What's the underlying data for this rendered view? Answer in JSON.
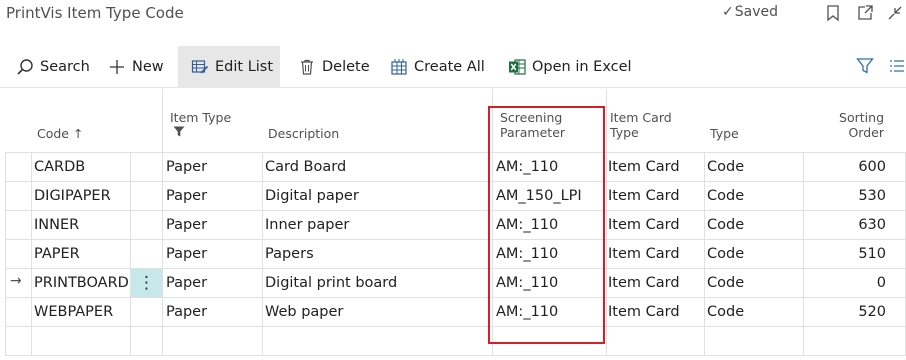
{
  "page": {
    "title": "PrintVis Item Type Code",
    "saved_label": "Saved",
    "icons": [
      "bookmark-icon",
      "open-new-window-icon",
      "collapse-icon"
    ]
  },
  "actions": {
    "search": "Search",
    "new": "New",
    "edit_list": "Edit List",
    "delete": "Delete",
    "create_all": "Create All",
    "open_excel": "Open in Excel"
  },
  "columns": {
    "code": "Code",
    "sort_indicator": "↑",
    "item_type": "Item Type",
    "description": "Description",
    "screening_line1": "Screening",
    "screening_line2": "Parameter",
    "item_card_line1": "Item Card",
    "item_card_line2": "Type",
    "type": "Type",
    "sorting_line1": "Sorting",
    "sorting_line2": "Order"
  },
  "rows": [
    {
      "code": "CARDB",
      "item_type": "Paper",
      "description": "Card Board",
      "screening": "AM:_110",
      "item_card_type": "Item Card",
      "type": "Code",
      "sorting_order": "600"
    },
    {
      "code": "DIGIPAPER",
      "item_type": "Paper",
      "description": "Digital paper",
      "screening": "AM_150_LPI",
      "item_card_type": "Item Card",
      "type": "Code",
      "sorting_order": "530"
    },
    {
      "code": "INNER",
      "item_type": "Paper",
      "description": "Inner paper",
      "screening": "AM:_110",
      "item_card_type": "Item Card",
      "type": "Code",
      "sorting_order": "630"
    },
    {
      "code": "PAPER",
      "item_type": "Paper",
      "description": "Papers",
      "screening": "AM:_110",
      "item_card_type": "Item Card",
      "type": "Code",
      "sorting_order": "510"
    },
    {
      "code": "PRINTBOARD",
      "item_type": "Paper",
      "description": "Digital print board",
      "screening": "AM:_110",
      "item_card_type": "Item Card",
      "type": "Code",
      "sorting_order": "0"
    },
    {
      "code": "WEBPAPER",
      "item_type": "Paper",
      "description": "Web paper",
      "screening": "AM:_110",
      "item_card_type": "Item Card",
      "type": "Code",
      "sorting_order": "520"
    }
  ],
  "selected_row_marker": "→",
  "row_menu_glyph": "⋮",
  "colors": {
    "highlight": "#d21f2a",
    "selected_cell": "#c7e8ea",
    "toolbar_active": "#e7e7e7",
    "accent": "#0078d4"
  }
}
